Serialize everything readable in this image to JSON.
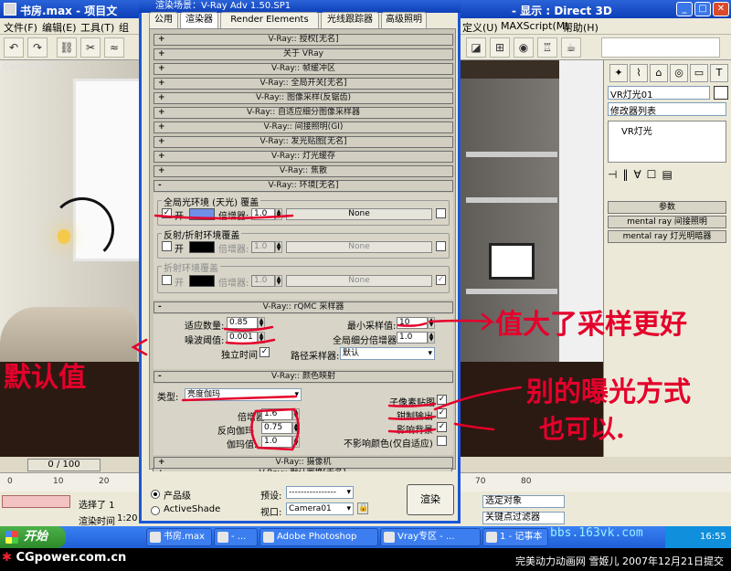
{
  "max_window": {
    "title_left": "书房.max  -  项目文",
    "title_right": "- 显示 : Direct 3D",
    "menu": [
      "文件(F)",
      "编辑(E)",
      "工具(T)",
      "组",
      "定义(U)",
      "MAXScript(M)",
      "帮助(H)"
    ],
    "viewport_label": "Camera01"
  },
  "render_dialog": {
    "title": "渲染场景：V-Ray Adv 1.50.SP1",
    "tabs": [
      "公用",
      "渲染器",
      "Render Elements",
      "光线跟踪器",
      "高级照明"
    ],
    "active_tab": 1,
    "rollouts_top": [
      "V-Ray:: 授权[无名]",
      "关于 VRay",
      "V-Ray:: 帧缓冲区",
      "V-Ray:: 全局开关[无名]",
      "V-Ray:: 图像采样(反锯齿)",
      "V-Ray:: 自适应细分图像采样器",
      "V-Ray:: 间接照明(GI)",
      "V-Ray:: 发光贴图[无名]",
      "V-Ray:: 灯光缓存",
      "V-Ray:: 焦散"
    ],
    "environment": {
      "header": "V-Ray:: 环境[无名]",
      "gi_group": "全局光环境 (天光) 覆盖",
      "refl_group": "反射/折射环境覆盖",
      "refr_group": "折射环境覆盖",
      "on_label": "开",
      "multiplier_label": "倍增器:",
      "gi_multiplier": "1.0",
      "refl_multiplier": "1.0",
      "refr_multiplier": "1.0",
      "map_none": "None",
      "gi_on": true,
      "refl_on": false,
      "refr_on": false,
      "gi_color": "#6f8fe8",
      "refl_color": "#000000",
      "refr_color": "#000000"
    },
    "rqmc": {
      "header": "V-Ray:: rQMC 采样器",
      "adaptive_label": "适应数量:",
      "adaptive_value": "0.85",
      "noise_label": "噪波阈值:",
      "noise_value": "0.001",
      "independent_label": "独立时间",
      "min_samples_label": "最小采样值:",
      "min_samples_value": "10",
      "global_subdiv_label": "全局细分倍增器:",
      "global_subdiv_value": "1.0",
      "path_sampler_label": "路径采样器:",
      "path_sampler_value": "默认"
    },
    "color_mapping": {
      "header": "V-Ray:: 颜色映射",
      "type_label": "类型:",
      "type_value": "亮度伽玛",
      "mult_label": "倍增器",
      "mult_value": "1.6",
      "inv_gamma_label": "反向伽玛",
      "inv_gamma_value": "0.75",
      "gamma_label": "伽玛值:",
      "gamma_value": "1.0",
      "subpixel_label": "子像素贴图",
      "clamp_label": "钳制输出",
      "affect_bg_label": "影响背景",
      "no_affect_label": "不影响颜色(仅自适应)"
    },
    "rollouts_bottom": [
      "V-Ray:: 摄像机",
      "V-Ray:: 默认置换[无名]"
    ],
    "footer": {
      "production": "产品级",
      "activeshade": "ActiveShade",
      "preset_label": "预设:",
      "preset_value": "----------------",
      "viewport_label": "视口:",
      "viewport_value": "Camera01",
      "render_label": "渲染"
    }
  },
  "command_panel": {
    "object_name": "VR灯光01",
    "modifier_list": "修改器列表",
    "stack_item": "VR灯光",
    "rollouts": [
      "参数",
      "mental ray 间接照明",
      "mental ray 灯光明暗器"
    ]
  },
  "status": {
    "time_slider": "0 / 100",
    "ruler_ticks": [
      "0",
      "10",
      "20",
      "30",
      "40",
      "50",
      "60",
      "70",
      "80"
    ],
    "selected": "选择了 1",
    "render_time_label": "渲染时间",
    "render_time": "1:20",
    "key_mode": "选定对象",
    "key_filter": "关键点过滤器"
  },
  "taskbar": {
    "start": "开始",
    "items": [
      "书房.max",
      "- ...",
      "Adobe Photoshop",
      "Vray专区 - ...",
      "1 - 记事本"
    ],
    "clock": "16:55"
  },
  "credit": {
    "logo_text": "CGpower.com.cn",
    "submit_text": "完美动力动画网 雪姬儿 2007年12月21日提交",
    "watermark": "bbs.163vk.com"
  },
  "annotations": {
    "default_value": "默认值",
    "bigger_samples": "值大了采样更好",
    "other_exposure": "别的曝光方式",
    "also_ok": "也可以."
  }
}
